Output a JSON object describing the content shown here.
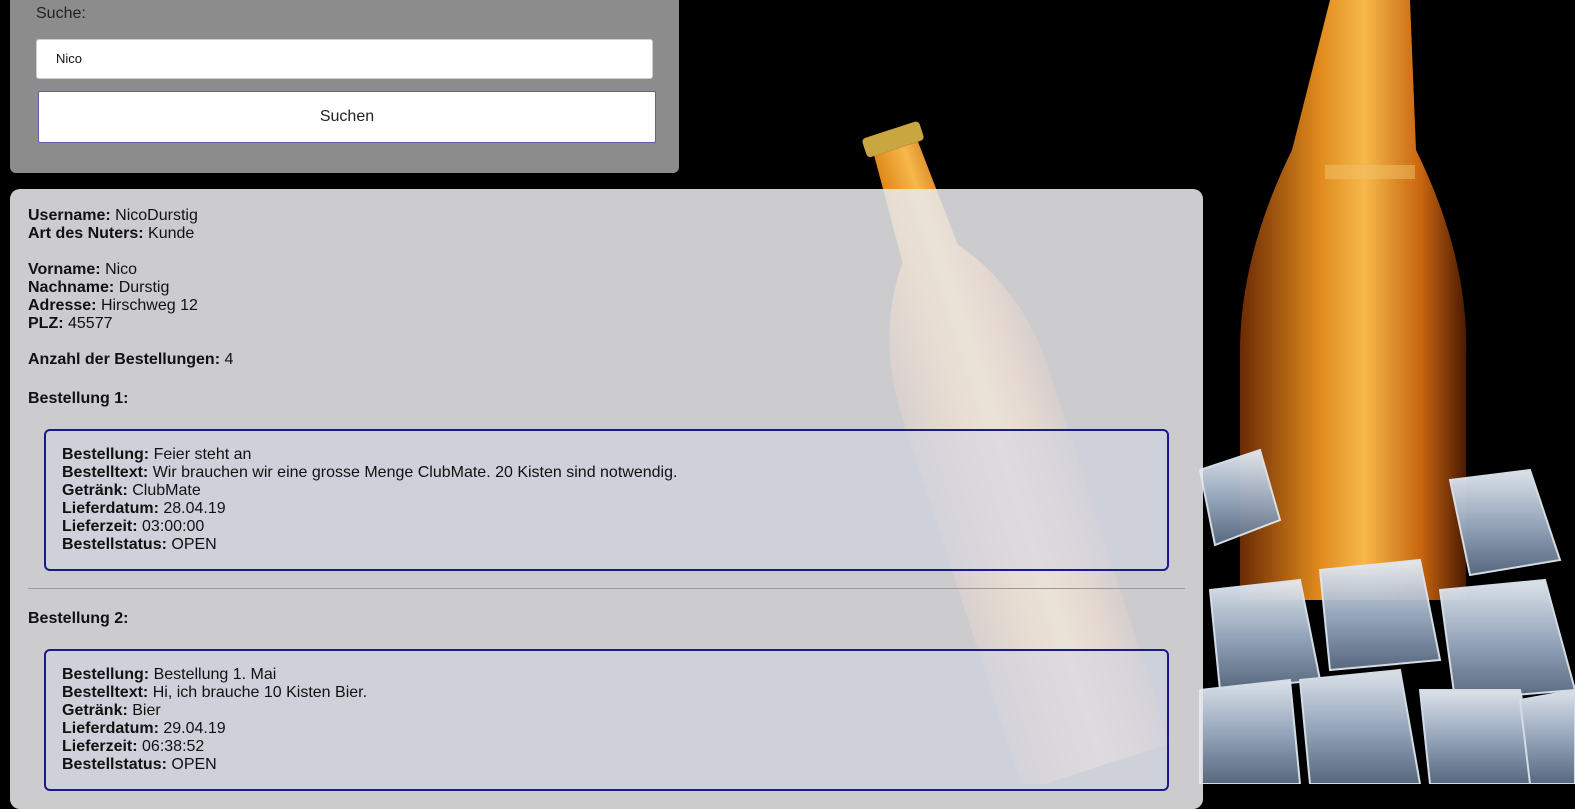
{
  "search": {
    "label": "Suche:",
    "value": "Nico",
    "button_label": "Suchen"
  },
  "user": {
    "username_label": "Username:",
    "username": "NicoDurstig",
    "type_label": "Art des Nuters:",
    "type": "Kunde",
    "firstname_label": "Vorname:",
    "firstname": "Nico",
    "lastname_label": "Nachname:",
    "lastname": "Durstig",
    "address_label": "Adresse:",
    "address": "Hirschweg 12",
    "zip_label": "PLZ:",
    "zip": "45577",
    "order_count_label": "Anzahl der Bestellungen:",
    "order_count": "4"
  },
  "field_labels": {
    "name": "Bestellung:",
    "text": "Bestelltext:",
    "drink": "Getränk:",
    "date": "Lieferdatum:",
    "time": "Lieferzeit:",
    "status": "Bestellstatus:"
  },
  "orders": [
    {
      "title": "Bestellung 1:",
      "name": "Feier steht an",
      "text": "Wir brauchen wir eine grosse Menge ClubMate. 20 Kisten sind notwendig.",
      "drink": "ClubMate",
      "date": "28.04.19",
      "time": "03:00:00",
      "status": "OPEN"
    },
    {
      "title": "Bestellung 2:",
      "name": "Bestellung 1. Mai",
      "text": "Hi, ich brauche 10 Kisten Bier.",
      "drink": "Bier",
      "date": "29.04.19",
      "time": "06:38:52",
      "status": "OPEN"
    }
  ],
  "colors": {
    "background": "#000000",
    "search_panel": "#8c8c8c",
    "order_border": "#1a1a8c",
    "beer": "#c8650f"
  }
}
